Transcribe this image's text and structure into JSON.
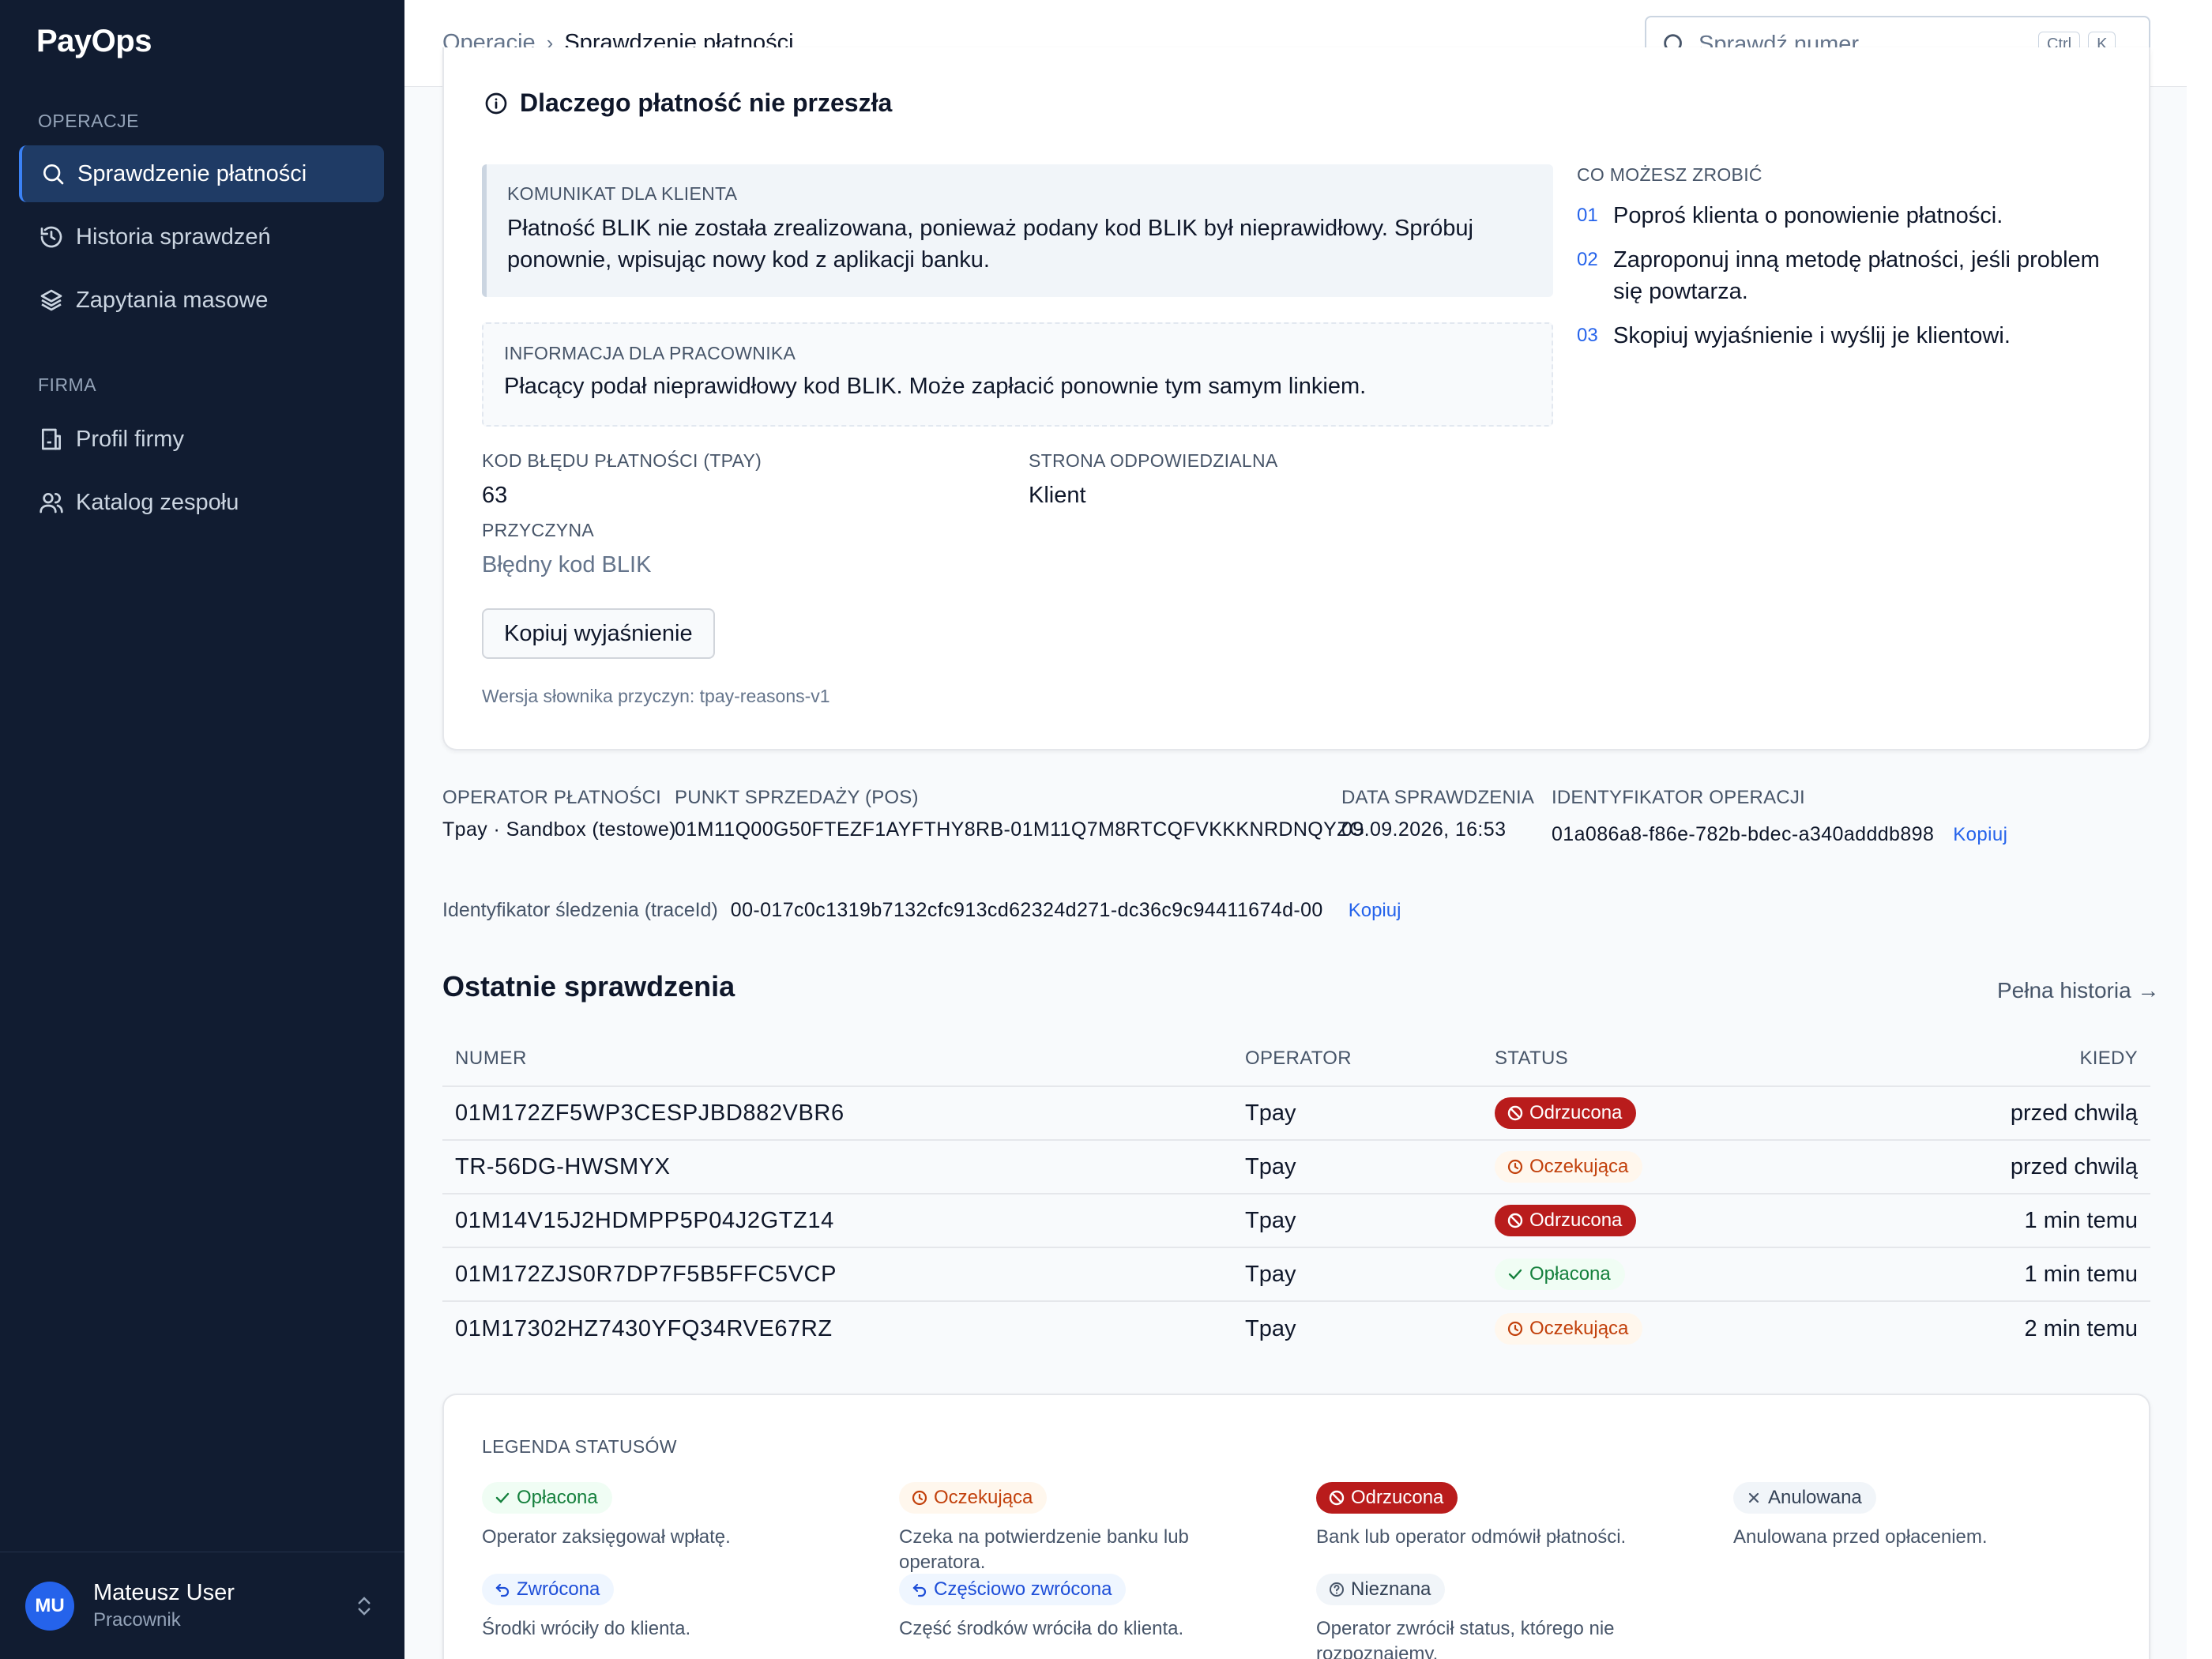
{
  "app": {
    "logo": "PayOps"
  },
  "sidebar": {
    "groups": [
      {
        "label": "OPERACJE",
        "items": [
          {
            "label": "Sprawdzenie płatności",
            "icon": "search-icon",
            "active": true
          },
          {
            "label": "Historia sprawdzeń",
            "icon": "history-icon"
          },
          {
            "label": "Zapytania masowe",
            "icon": "layers-icon"
          }
        ]
      },
      {
        "label": "FIRMA",
        "items": [
          {
            "label": "Profil firmy",
            "icon": "building-icon"
          },
          {
            "label": "Katalog zespołu",
            "icon": "users-icon"
          }
        ]
      }
    ],
    "user": {
      "initials": "MU",
      "name": "Mateusz User",
      "role": "Pracownik"
    }
  },
  "topbar": {
    "breadcrumb": {
      "parent": "Operacje",
      "separator": "›",
      "current": "Sprawdzenie płatności"
    },
    "search": {
      "placeholder": "Sprawdź numer...",
      "value": "",
      "shortcut_mod": "Ctrl",
      "shortcut_key": "K"
    }
  },
  "reason": {
    "title": "Dlaczego płatność nie przeszła",
    "client_message": {
      "label": "KOMUNIKAT DLA KLIENTA",
      "text": "Płatność BLIK nie została zrealizowana, ponieważ podany kod BLIK był nieprawidłowy. Spróbuj ponownie, wpisując nowy kod z aplikacji banku."
    },
    "staff_message": {
      "label": "INFORMACJA DLA PRACOWNIKA",
      "text": "Płacący podał nieprawidłowy kod BLIK. Może zapłacić ponownie tym samym linkiem."
    },
    "error_code": {
      "label": "KOD BŁĘDU PŁATNOŚCI (TPAY)",
      "value": "63"
    },
    "responsible": {
      "label": "STRONA ODPOWIEDZIALNA",
      "value": "Klient"
    },
    "cause": {
      "label": "PRZYCZYNA",
      "value": "Błędny kod BLIK"
    },
    "copy_button": "Kopiuj wyjaśnienie",
    "dictionary_version": "Wersja słownika przyczyn: tpay-reasons-v1",
    "actions_label": "CO MOŻESZ ZROBIĆ",
    "actions": [
      {
        "num": "01",
        "text": "Poproś klienta o ponowienie płatności."
      },
      {
        "num": "02",
        "text": "Zaproponuj inną metodę płatności, jeśli problem się powtarza."
      },
      {
        "num": "03",
        "text": "Skopiuj wyjaśnienie i wyślij je klientowi."
      }
    ]
  },
  "meta": {
    "operator": {
      "label": "OPERATOR PŁATNOŚCI",
      "value": "Tpay · Sandbox (testowe)"
    },
    "pos": {
      "label": "PUNKT SPRZEDAŻY (POS)",
      "value": "01M11Q00G50FTEZF1AYFTHY8RB-01M11Q7M8RTCQFVKKKNRDNQYZG"
    },
    "date": {
      "label": "DATA SPRAWDZENIA",
      "value": "09.09.2026, 16:53"
    },
    "operation_id": {
      "label": "IDENTYFIKATOR OPERACJI",
      "value": "01a086a8-f86e-782b-bdec-a340adddb898",
      "copy": "Kopiuj"
    },
    "trace": {
      "label": "Identyfikator śledzenia (traceId)",
      "value": "00-017c0c1319b7132cfc913cd62324d271-dc36c9c94411674d-00",
      "copy": "Kopiuj"
    }
  },
  "recent": {
    "title": "Ostatnie sprawdzenia",
    "full_history": "Pełna historia →",
    "columns": {
      "number": "NUMER",
      "operator": "OPERATOR",
      "status": "STATUS",
      "when": "KIEDY"
    },
    "rows": [
      {
        "number": "01M172ZF5WP3CESPJBD882VBR6",
        "operator": "Tpay",
        "status": "Odrzucona",
        "status_type": "rejected",
        "when": "przed chwilą"
      },
      {
        "number": "TR-56DG-HWSMYX",
        "operator": "Tpay",
        "status": "Oczekująca",
        "status_type": "pending",
        "when": "przed chwilą"
      },
      {
        "number": "01M14V15J2HDMPP5P04J2GTZ14",
        "operator": "Tpay",
        "status": "Odrzucona",
        "status_type": "rejected",
        "when": "1 min temu"
      },
      {
        "number": "01M172ZJS0R7DP7F5B5FFC5VCP",
        "operator": "Tpay",
        "status": "Opłacona",
        "status_type": "paid",
        "when": "1 min temu"
      },
      {
        "number": "01M17302HZ7430YFQ34RVE67RZ",
        "operator": "Tpay",
        "status": "Oczekująca",
        "status_type": "pending",
        "when": "2 min temu"
      }
    ]
  },
  "legend": {
    "title": "LEGENDA STATUSÓW",
    "items": [
      {
        "label": "Opłacona",
        "type": "paid",
        "icon": "check-icon",
        "desc": "Operator zaksięgował wpłatę."
      },
      {
        "label": "Oczekująca",
        "type": "pending",
        "icon": "clock-icon",
        "desc": "Czeka na potwierdzenie banku lub operatora."
      },
      {
        "label": "Odrzucona",
        "type": "rejected",
        "icon": "ban-icon",
        "desc": "Bank lub operator odmówił płatności."
      },
      {
        "label": "Anulowana",
        "type": "cancel",
        "icon": "x-icon",
        "desc": "Anulowana przed opłaceniem."
      },
      {
        "label": "Zwrócona",
        "type": "refund",
        "icon": "undo-icon",
        "desc": "Środki wróciły do klienta."
      },
      {
        "label": "Częściowo zwrócona",
        "type": "refund",
        "icon": "undo-icon",
        "desc": "Część środków wróciła do klienta."
      },
      {
        "label": "Nieznana",
        "type": "unknown",
        "icon": "help-icon",
        "desc": "Operator zwrócił status, którego nie rozpoznajemy."
      }
    ]
  },
  "colors": {
    "sidebar_bg": "#111c31",
    "accent": "#2563eb",
    "rejected": "#b91c1c",
    "pending": "#c2410c",
    "paid": "#15803d"
  }
}
